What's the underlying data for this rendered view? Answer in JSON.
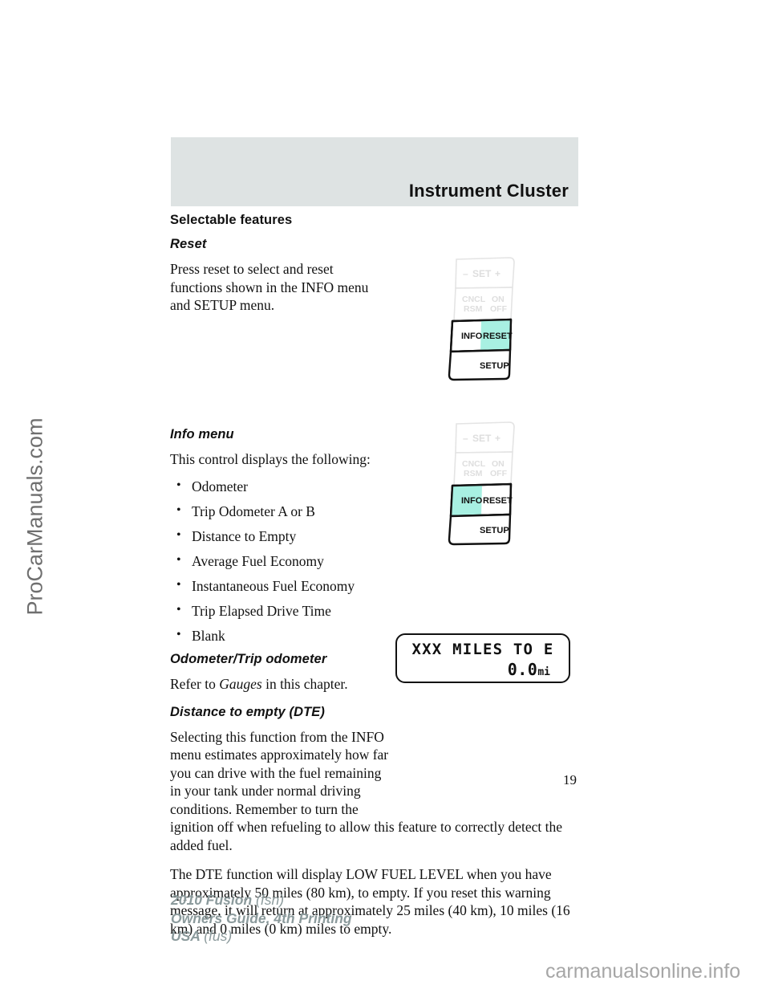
{
  "watermarks": {
    "side": "ProCarManuals.com",
    "bottom": "carmanualsonline.info"
  },
  "header": {
    "title": "Instrument Cluster"
  },
  "page_number": "19",
  "sections": {
    "selectable_features": {
      "heading": "Selectable features",
      "reset": {
        "heading": "Reset",
        "body": "Press reset to select and reset functions shown in the INFO menu and SETUP menu."
      }
    },
    "info_menu": {
      "heading": "Info menu",
      "intro": "This control displays the following:",
      "items": [
        "Odometer",
        "Trip Odometer A or B",
        "Distance to Empty",
        "Average Fuel Economy",
        "Instantaneous Fuel Economy",
        "Trip Elapsed Drive Time",
        "Blank"
      ]
    },
    "odometer": {
      "heading": "Odometer/Trip odometer",
      "body_before": "Refer to ",
      "body_italic": "Gauges",
      "body_after": " in this chapter."
    },
    "dte": {
      "heading": "Distance to empty (DTE)",
      "para1": "Selecting this function from the INFO menu estimates approximately how far you can drive with the fuel remaining in your tank under normal driving conditions. Remember to turn the ignition off when refueling to allow this feature to correctly detect the added fuel.",
      "para2": "The DTE function will display LOW FUEL LEVEL when you have approximately 50 miles (80 km), to empty. If you reset this warning message, it will return at approximately 25 miles (40 km), 10 miles (16 km) and 0 miles (0 km) miles to empty."
    }
  },
  "switch_figures": [
    {
      "id": "reset-switch",
      "labels": {
        "minus": "–",
        "set": "SET",
        "plus": "+",
        "cncl": "CNCL",
        "rsm": "RSM",
        "on": "ON",
        "off": "OFF",
        "info": "INFO",
        "reset": "RESET",
        "setup": "SETUP"
      },
      "highlighted": "RESET"
    },
    {
      "id": "info-switch",
      "labels": {
        "minus": "–",
        "set": "SET",
        "plus": "+",
        "cncl": "CNCL",
        "rsm": "RSM",
        "on": "ON",
        "off": "OFF",
        "info": "INFO",
        "reset": "RESET",
        "setup": "SETUP"
      },
      "highlighted": "INFO"
    }
  ],
  "lcd_display": {
    "line1": "XXX MILES TO E",
    "line2_value": "0.0",
    "line2_unit": "mi"
  },
  "footer": {
    "line1_bold": "2010 Fusion",
    "line1_light": "(fsn)",
    "line2_bold": "Owners Guide, 4th Printing",
    "line3_bold": "USA",
    "line3_light": "(fus)"
  },
  "colors": {
    "banner": "#dee3e3",
    "highlight": "#a8f0e2",
    "ghost": "#e8e8e8",
    "footer_text": "#8b9a9c"
  }
}
